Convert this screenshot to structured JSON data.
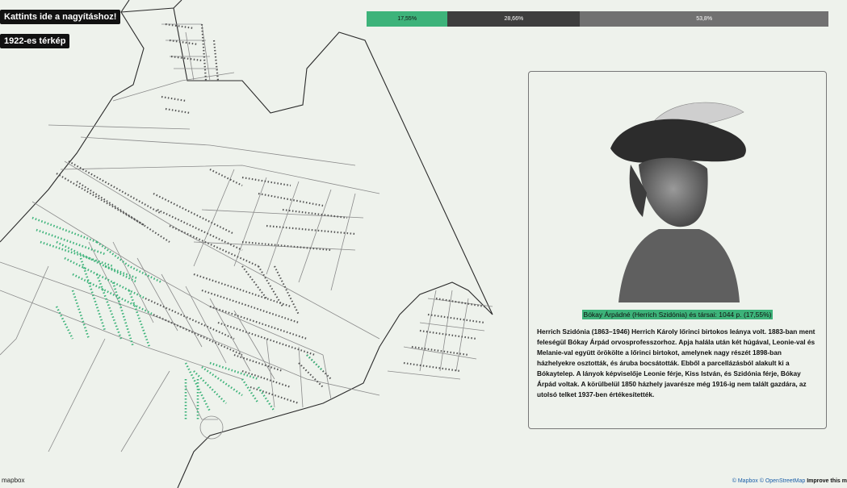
{
  "buttons": {
    "zoom": "Kattints ide a nagyításhoz!",
    "map1922": "1922-es térkép"
  },
  "progress": [
    {
      "label": "17,55%",
      "value": 17.55,
      "color": "#3db37a",
      "text_color": "#111111"
    },
    {
      "label": "28,66%",
      "value": 28.66,
      "color": "#3e3e3e",
      "text_color": "#ffffff"
    },
    {
      "label": "53,8%",
      "value": 53.8,
      "color": "#717171",
      "text_color": "#ffffff"
    }
  ],
  "panel": {
    "caption": "Bókay Árpádné (Herrich Szidónia) és társai: 1044 p. (17,55%)",
    "description": "Herrich Szidónia (1863–1946) Herrich Károly lőrinci birtokos leánya volt. 1883-ban ment feleségül Bókay Árpád orvosprofesszorhoz. Apja halála után két húgával, Leonie-val és Melanie-val együtt örökölte a lőrinci birtokot, amelynek nagy részét 1898-ban házhelyekre osztották, és áruba bocsátották. Ebből a parcellázásból alakult ki a Bókaytelep. A lányok képviselője Leonie férje, Kiss István, és Szidónia férje, Bókay Árpád voltak. A körülbelül 1850 házhely javarésze még 1916-ig nem talált gazdára, az utolsó telket 1937-ben értékesítették.",
    "portrait_icon": "portrait-photo"
  },
  "footer": {
    "mapbox_logo": "mapbox",
    "attribution_mapbox": "© Mapbox",
    "attribution_osm": "© OpenStreetMap",
    "improve": "Improve this m"
  },
  "colors": {
    "highlight": "#3db37a",
    "background": "#eef2ec",
    "road": "#8a8a8a"
  }
}
